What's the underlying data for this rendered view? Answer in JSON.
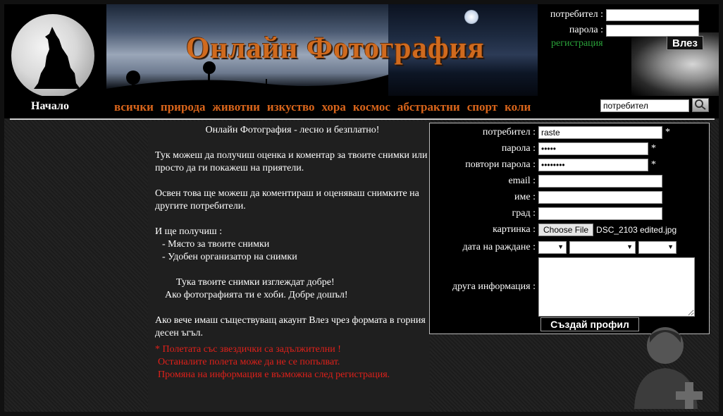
{
  "site": {
    "title": "Онлайн Фотография"
  },
  "login": {
    "user_label": "потребител :",
    "pass_label": "парола :",
    "register_link": "регистрация",
    "login_button": "Влез"
  },
  "nav": {
    "home": "Начало",
    "categories": [
      "всички",
      "природа",
      "животни",
      "изкуство",
      "хора",
      "космос",
      "абстрактни",
      "спорт",
      "коли"
    ],
    "search_value": "потребител"
  },
  "intro": {
    "heading": "Онлайн Фотография - лесно и безплатно!",
    "p1": "Тук можеш да получиш оценка и коментар за твоите снимки или просто да ги покажеш на приятели.",
    "p2": "Освен това ще можеш да коментираш и оценяваш снимките на другите потребители.",
    "p3": "И ще получиш :",
    "b1": "- Място за твоите снимки",
    "b2": "- Удобен организатор на снимки",
    "c1": "Тука твоите снимки изглеждат добре!",
    "c2": "Ако фотографията ти е хоби. Добре дошъл!",
    "p4": "Ако вече имаш съществуващ акаунт Влез чрез формата в горния десен ъгъл."
  },
  "notes": {
    "n1": "* Полетата със звездички са задължителни !",
    "n2": "Останалите полета може да не се попълват.",
    "n3": "Промяна на информация е възможна след регистрация."
  },
  "form": {
    "user_label": "потребител :",
    "user_value": "raste",
    "pass_label": "парола :",
    "pass_value": "•••••",
    "repass_label": "повтори парола :",
    "repass_value": "••••••••",
    "email_label": "email :",
    "name_label": "име :",
    "city_label": "град :",
    "picture_label": "картинка :",
    "choose_file": "Choose File",
    "file_name": "DSC_2103 edited.jpg",
    "birth_label": "дата на раждане :",
    "other_label": "друга информация :",
    "required_mark": "*",
    "create_button": "Създай профил"
  },
  "colors": {
    "accent": "#d9651b",
    "register": "#2aa33a",
    "required": "#e0201a"
  }
}
